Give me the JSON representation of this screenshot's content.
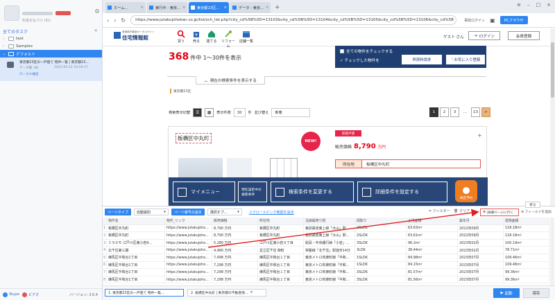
{
  "left_pane": {
    "user_sub": "料金を払うけ (ID)",
    "all_tasks": "全てのタスク",
    "tree": [
      {
        "label": "test"
      },
      {
        "label": "Samples"
      },
      {
        "label": "デフォルト"
      }
    ],
    "task": {
      "title": "東京都23区の一戸建て 物件一覧 | 東京都23...",
      "meta": "データ数: 80",
      "date": "2023-04-12 16:18:17",
      "sub": "ローカル抽出"
    },
    "skype": "Skype",
    "lightning": "ビデオ",
    "version": "バージョン: 3.6.4"
  },
  "browser": {
    "tabs": [
      {
        "label": "ホーム..."
      },
      {
        "label": "実行中 - 東京..."
      },
      {
        "label": "東京都23区..."
      },
      {
        "label": "データ - 東京..."
      }
    ],
    "url": "https://www.jutakujohokan.co.jp/list/sch_list.php?city_cd%5B%5D=13103&city_cd%5B%5D=13104&city_cd%5B%5D=13105&city_cd%5B%5D=13106&city_cd%5B",
    "login_link": "事前ログイン",
    "pc_browser": "PCブラウザ"
  },
  "site": {
    "logo_tag": "首都圏不動産ポータルサイト",
    "logo": "住宅情報館",
    "nav": [
      {
        "label": "買う"
      },
      {
        "label": "売る"
      },
      {
        "label": "建てる"
      },
      {
        "label": "リフォーム"
      },
      {
        "label": "店舗一覧"
      }
    ],
    "guest": "ゲスト さん",
    "login": "ログイン",
    "register": "会員登録",
    "count_num": "368",
    "count_text": "件中 1～30件を表示",
    "check_all": "全ての物件をチェックする",
    "checked": "チェックした物件を",
    "request": "資料請求",
    "favorite": "お気に入り登録",
    "cond_toggle": "現在の検索条件を表示する",
    "area": "東京都23区",
    "view_label": "検索表示切替",
    "per_page_label": "表示件数",
    "per_page": "30",
    "per_page_unit": "件",
    "sort_label": "並び替え",
    "sort_value": "新着",
    "pager": [
      "1",
      "2",
      "3",
      "…",
      "13",
      ">"
    ],
    "card": {
      "title": "板橋区中丸町",
      "badge": "NEW!",
      "type": "新築戸建",
      "price_label": "販売価格",
      "price": "8,790",
      "price_unit": "万円",
      "row_head": "所在地",
      "row_value": "板橋区中丸町"
    },
    "banner": {
      "mymenu": "マイメニュー",
      "current": "現在設定中の検索条件",
      "change": "検索条件を変更する",
      "set": "詳細条件を設定する",
      "call": "来店予約"
    }
  },
  "extract": {
    "tag1": "ページタイプ",
    "sel1": "自動識別",
    "tag2": "ページ番号の設定",
    "sel2": "選択オプ...",
    "scroll_link": "スクロールビング範囲を設定",
    "filter": "フィルター",
    "clear": "クリア",
    "detail": "詳細ページに行く",
    "add_field": "フィールドを追加",
    "collapse": "折る",
    "columns": [
      "物件名",
      "物件_リンク",
      "販売価格",
      "所在地",
      "沿線最寄り駅",
      "間取り",
      "土地面積",
      "築年月",
      "建物面積"
    ],
    "rows": [
      [
        "板橋区中丸町",
        "https://www.jutakujoho...",
        "8,790 万円",
        "板橋区中丸町",
        "東武鉄道東上線「大山」駅...",
        "2SLDK",
        "63.63m²",
        "2022年09月",
        "118.18m²"
      ],
      [
        "板橋区中丸町",
        "https://www.jutakujoho...",
        "8,790 万円",
        "板橋区中丸町",
        "東武鉄道東上線「大山」駅...",
        "2SLDK",
        "63.61m²",
        "2022年09月",
        "118.18m²"
      ],
      [
        "ミラスモ 江戸川区東小岩9...",
        "https://www.jutakujoho...",
        "5,280 万円",
        "江戸川区東小岩９丁目",
        "総武・中央緩行線「小岩」...",
        "3SLDK",
        "96.2m²",
        "2023年02月",
        "100.19m²"
      ],
      [
        "北千住第三期",
        "https://www.jutakujoho...",
        "4,480 万円",
        "足立区千住 柳町",
        "常磐線「北千住」駅徒歩14分",
        "3LDK",
        "38.44m²",
        "2023年01月",
        "78.71m²"
      ],
      [
        "練馬区平和台1丁目",
        "https://www.jutakujoho...",
        "7,498 万円",
        "練馬区平和台１丁目",
        "東京メトロ有楽町線「平和...",
        "1SLDK",
        "84.98m²",
        "2023年07月",
        "109.46m²"
      ],
      [
        "練馬区平和台1丁目",
        "https://www.jutakujoho...",
        "7,298 万円",
        "練馬区平和台１丁目",
        "東京メトロ有楽町線「平和...",
        "1SLDK",
        "84.15m²",
        "2023年07月",
        "109.46m²"
      ],
      [
        "練馬区平和台1丁目",
        "https://www.jutakujoho...",
        "7,298 万円",
        "練馬区平和台１丁目",
        "東京メトロ有楽町線「平和...",
        "3SLDK",
        "81.57m²",
        "2023年07月",
        "99.36m²"
      ],
      [
        "練馬区平和台1丁目",
        "https://www.jutakujoho...",
        "7,298 万円",
        "練馬区平和台１丁目",
        "東京メトロ有楽町線「平和...",
        "3SLDK",
        "81.56m²",
        "2023年07月",
        "99.36m²"
      ]
    ],
    "bottom_tab1": "1. 東京都23区の一戸建て 物件一覧...",
    "bottom_tab2": "2. 板橋区中丸町 | 東京都の不動産情...",
    "run": "起動",
    "save": "保存"
  },
  "colors": {
    "accent": "#2f86f0",
    "navy": "#1f3f72",
    "red": "#e60012",
    "annotation": "#e02020"
  }
}
